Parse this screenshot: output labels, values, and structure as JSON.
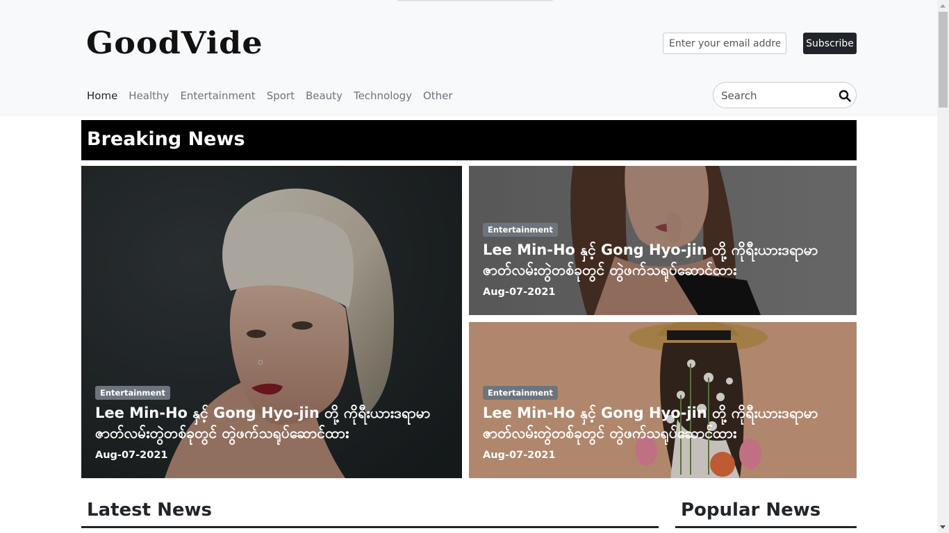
{
  "header": {
    "logo": "GoodVide",
    "email_placeholder": "Enter your email address...",
    "subscribe_label": "Subscribe",
    "search_placeholder": "Search"
  },
  "nav": {
    "items": [
      {
        "label": "Home",
        "active": true
      },
      {
        "label": "Healthy"
      },
      {
        "label": "Entertainment"
      },
      {
        "label": "Sport"
      },
      {
        "label": "Beauty"
      },
      {
        "label": "Technology"
      },
      {
        "label": "Other"
      }
    ]
  },
  "breaking": {
    "title": "Breaking News",
    "cards": [
      {
        "category": "Entertainment",
        "title": "Lee Min-Ho နှင့် Gong Hyo-jin တို့ ကိုရီးယားဒရာမာ ဇာတ်လမ်းတွဲတစ်ခုတွင် တွဲဖက်သရုပ်ဆောင်ထား",
        "date": "Aug-07-2021"
      },
      {
        "category": "Entertainment",
        "title": "Lee Min-Ho နှင့် Gong Hyo-jin တို့ ကိုရီးယားဒရာမာ ဇာတ်လမ်းတွဲတစ်ခုတွင် တွဲဖက်သရုပ်ဆောင်ထား",
        "date": "Aug-07-2021"
      },
      {
        "category": "Entertainment",
        "title": "Lee Min-Ho နှင့် Gong Hyo-jin တို့ ကိုရီးယားဒရာမာ ဇာတ်လမ်းတွဲတစ်ခုတွင် တွဲဖက်သရုပ်ဆောင်ထား",
        "date": "Aug-07-2021"
      }
    ]
  },
  "sections": {
    "latest_title": "Latest News",
    "popular_title": "Popular News"
  },
  "colors": {
    "header_bg": "#f8f9fa",
    "banner_bg": "#000000",
    "badge_bg": "#6c757d",
    "button_bg": "#212529"
  }
}
